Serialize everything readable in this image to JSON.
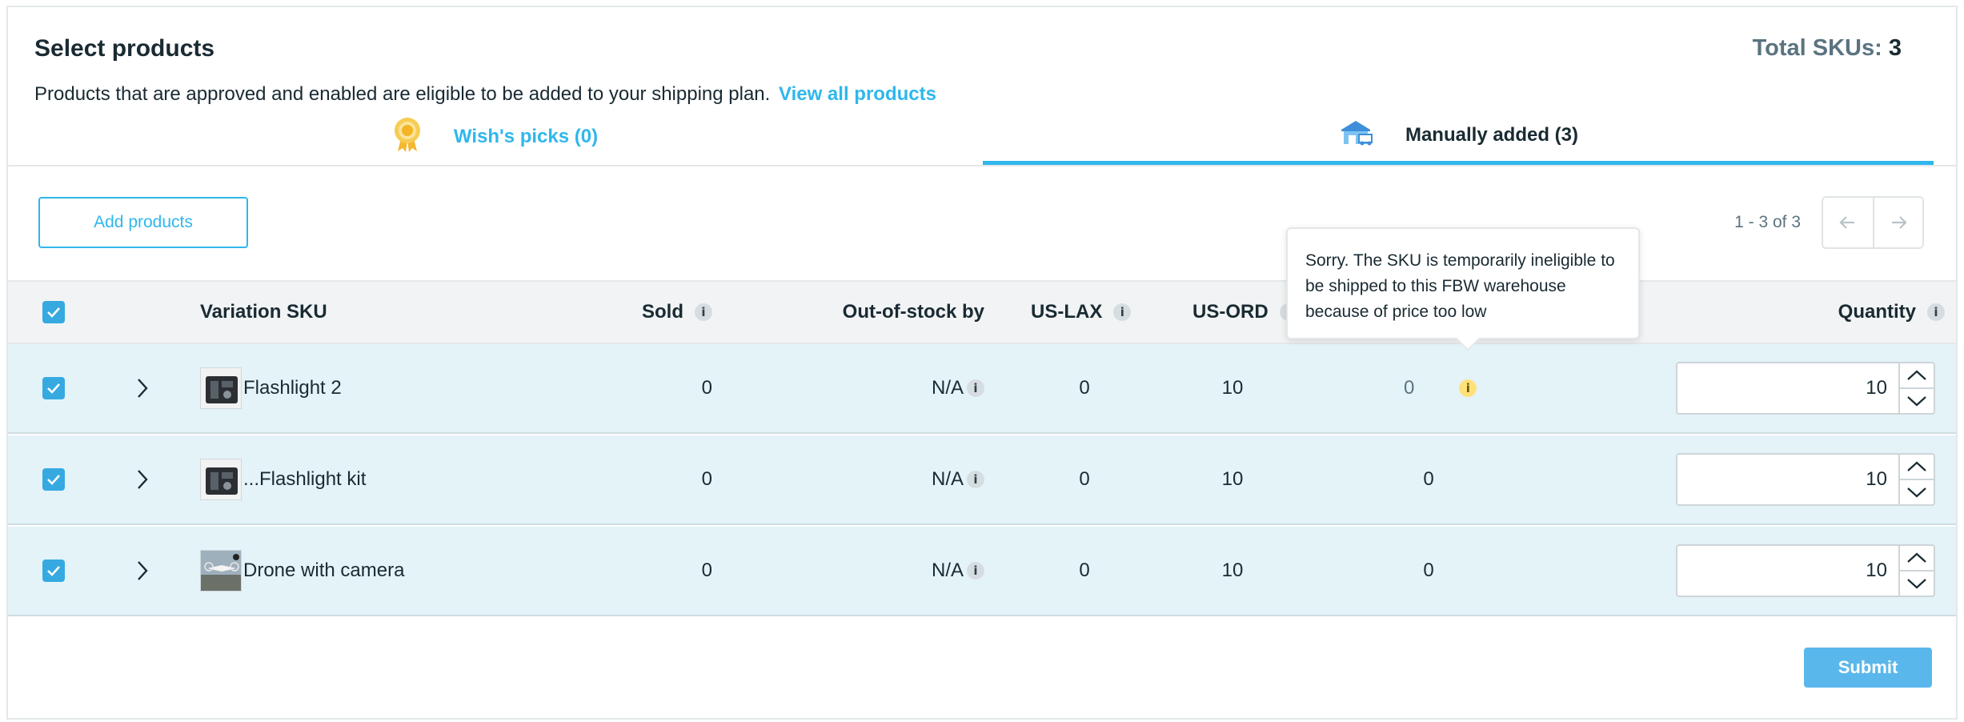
{
  "header": {
    "title": "Select products",
    "total_label": "Total SKUs:",
    "total_value": "3",
    "subtitle": "Products that are approved and enabled are eligible to be added to your shipping plan.",
    "view_all_link": "View all products"
  },
  "tabs": [
    {
      "label": "Wish's picks (0)",
      "icon": "award-ribbon-icon",
      "active": false
    },
    {
      "label": "Manually added (3)",
      "icon": "warehouse-icon",
      "active": true
    }
  ],
  "toolbar": {
    "add_button": "Add products",
    "pagination": "1 - 3 of 3"
  },
  "table": {
    "columns": [
      "Variation SKU",
      "Sold",
      "Out-of-stock by",
      "US-LAX",
      "US-ORD",
      "Quantity"
    ],
    "rows": [
      {
        "checked": true,
        "sku": "Flashlight 2",
        "sold": "0",
        "out_of_stock": "N/A",
        "us_lax": "0",
        "us_ord": "10",
        "extra": "0",
        "extra_warning": true,
        "quantity": "10"
      },
      {
        "checked": true,
        "sku": "...Flashlight kit",
        "sold": "0",
        "out_of_stock": "N/A",
        "us_lax": "0",
        "us_ord": "10",
        "extra": "0",
        "extra_warning": false,
        "quantity": "10"
      },
      {
        "checked": true,
        "sku": "Drone with camera",
        "sold": "0",
        "out_of_stock": "N/A",
        "us_lax": "0",
        "us_ord": "10",
        "extra": "0",
        "extra_warning": false,
        "quantity": "10"
      }
    ]
  },
  "tooltip": {
    "text": "Sorry. The SKU is temporarily ineligible to be shipped to this FBW warehouse because of price too low"
  },
  "footer": {
    "submit_label": "Submit"
  },
  "colors": {
    "accent": "#2fb7ec",
    "checkbox": "#36a9e1",
    "row_bg": "#e4f3f8",
    "header_bg": "#f1f3f4",
    "warning": "#ffe17a",
    "submit_bg": "#5ab7ec"
  }
}
